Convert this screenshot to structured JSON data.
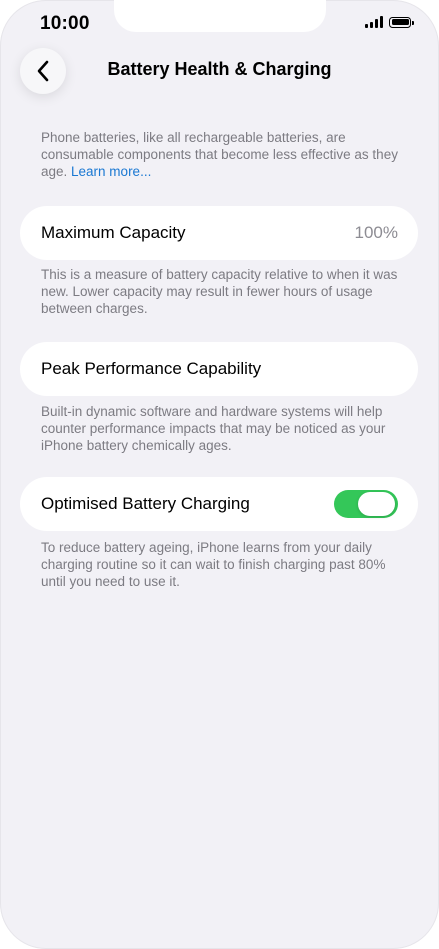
{
  "status_bar": {
    "time": "10:00"
  },
  "nav": {
    "title": "Battery Health & Charging",
    "back_icon": "chevron-left-icon"
  },
  "intro": {
    "text": "Phone batteries, like all rechargeable batteries, are consumable components that become less effective as they age. ",
    "link": "Learn more..."
  },
  "maximum_capacity": {
    "label": "Maximum Capacity",
    "value": "100%",
    "footnote": "This is a measure of battery capacity relative to when it was new. Lower capacity may result in fewer hours of usage between charges."
  },
  "peak_performance": {
    "label": "Peak Performance Capability",
    "footnote": "Built-in dynamic software and hardware systems will help counter performance impacts that may be noticed as your iPhone battery chemically ages."
  },
  "optimised_charging": {
    "label": "Optimised Battery Charging",
    "enabled": true,
    "toggle_color": "#34c759",
    "footnote": "To reduce battery ageing, iPhone learns from your daily charging routine so it can wait to finish charging past 80% until you need to use it."
  }
}
